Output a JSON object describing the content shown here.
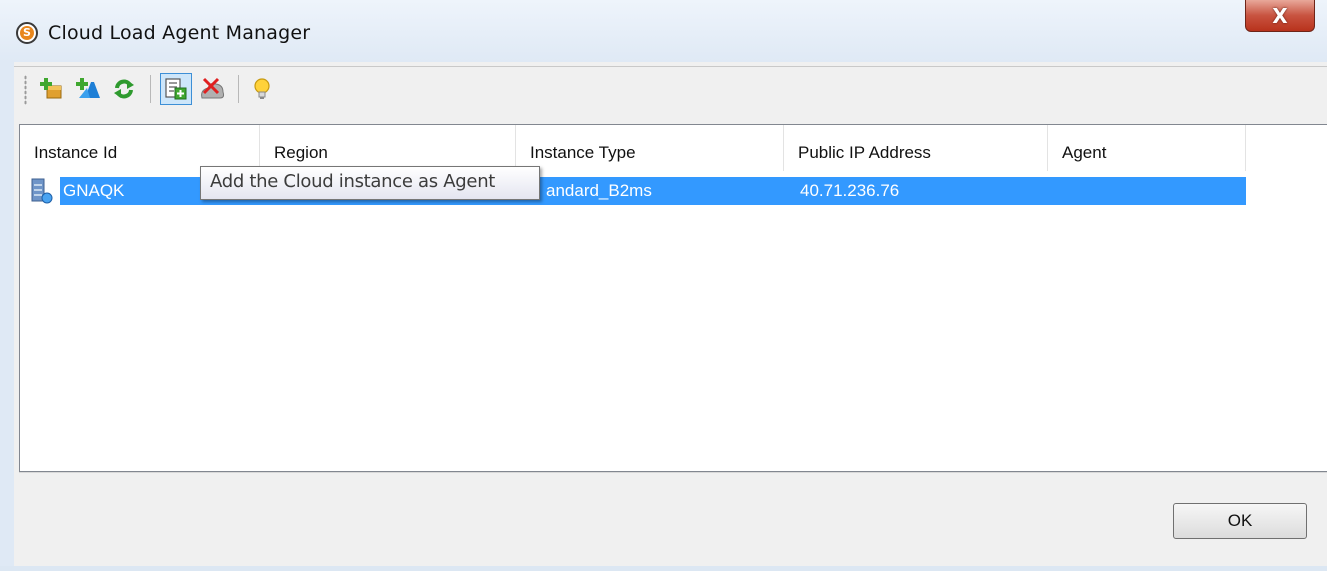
{
  "window": {
    "title": "Cloud Load Agent Manager",
    "close_label": "X",
    "app_icon_letter": "S"
  },
  "toolbar": {
    "buttons": [
      {
        "icon": "add-instance-icon",
        "label": "Add Instance"
      },
      {
        "icon": "add-azure-instance-icon",
        "label": "Add Azure Instance"
      },
      {
        "icon": "refresh-icon",
        "label": "Refresh"
      },
      {
        "icon": "add-agent-icon",
        "label": "Add the Cloud instance as Agent"
      },
      {
        "icon": "delete-instance-icon",
        "label": "Delete Instance"
      },
      {
        "icon": "tip-bulb-icon",
        "label": "Tips"
      }
    ]
  },
  "table": {
    "columns": [
      "Instance Id",
      "Region",
      "Instance Type",
      "Public IP Address",
      "Agent"
    ],
    "rows": [
      {
        "instance_id": "GNAQK",
        "region": "",
        "instance_type": "Standard_B2ms",
        "public_ip": "40.71.236.76",
        "agent": ""
      }
    ],
    "visible_instance_type": "andard_B2ms"
  },
  "tooltip": {
    "text": "Add the Cloud instance as Agent"
  },
  "footer": {
    "ok_label": "OK"
  },
  "colors": {
    "selection": "#3399ff",
    "close_button": "#c85340",
    "active_toolbar_border": "#3d8fd6"
  }
}
